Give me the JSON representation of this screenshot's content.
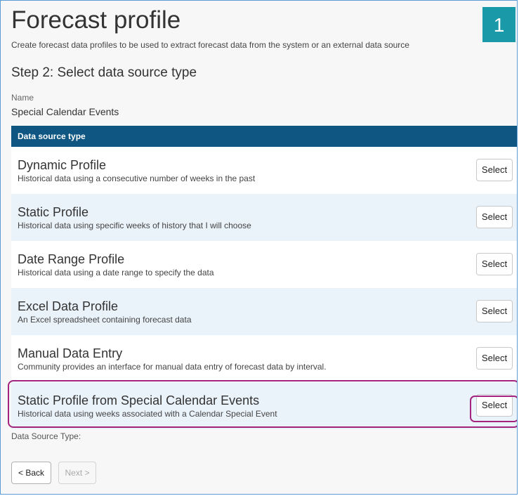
{
  "header": {
    "title": "Forecast profile",
    "subtitle": "Create forecast data profiles to be used to extract forecast data from the system or an external data source",
    "step_badge": "1"
  },
  "step": {
    "title": "Step 2: Select data source type"
  },
  "name_field": {
    "label": "Name",
    "value": "Special Calendar Events"
  },
  "table": {
    "header": "Data source type",
    "rows": [
      {
        "title": "Dynamic Profile",
        "description": "Historical data using a consecutive number of weeks in the past",
        "button": "Select"
      },
      {
        "title": "Static Profile",
        "description": "Historical data using specific weeks of history that I will choose",
        "button": "Select"
      },
      {
        "title": "Date Range Profile",
        "description": "Historical data using a date range to specify the data",
        "button": "Select"
      },
      {
        "title": "Excel Data Profile",
        "description": "An Excel spreadsheet containing forecast data",
        "button": "Select"
      },
      {
        "title": "Manual Data Entry",
        "description": "Community provides an interface for manual data entry of forecast data by interval.",
        "button": "Select"
      },
      {
        "title": "Static Profile from Special Calendar Events",
        "description": "Historical data using weeks associated with a Calendar Special Event",
        "button": "Select"
      }
    ]
  },
  "footer": {
    "data_source_type_label": "Data Source Type:",
    "back_label": "< Back",
    "next_label": "Next >"
  },
  "colors": {
    "header_bar": "#0f5682",
    "badge": "#1a9aa9",
    "highlight": "#a3247e",
    "row_alt": "#eaf2fa"
  }
}
